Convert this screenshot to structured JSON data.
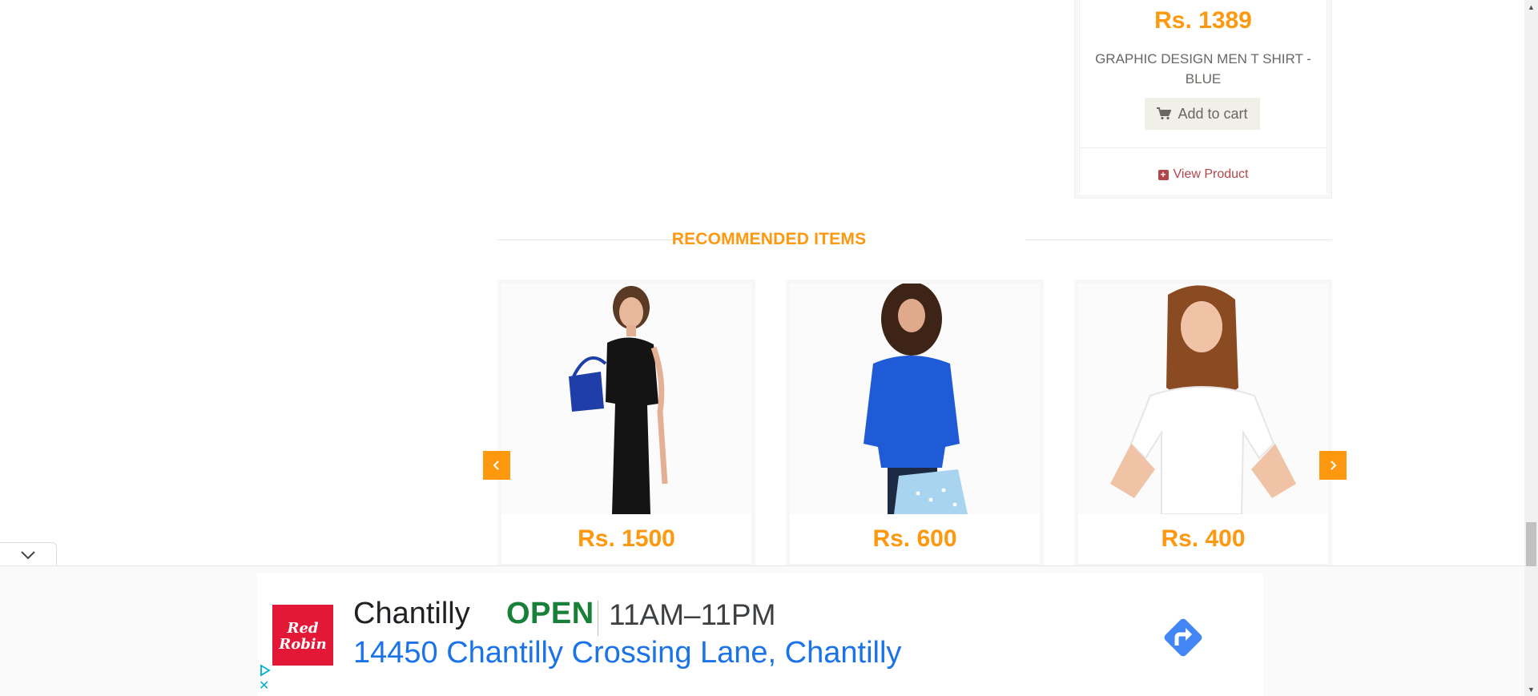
{
  "top_product": {
    "price": "Rs. 1389",
    "name": "GRAPHIC DESIGN MEN T SHIRT - BLUE",
    "add_to_cart": "Add to cart",
    "view_product": "View Product"
  },
  "recommended": {
    "title": "RECOMMENDED ITEMS",
    "items": [
      {
        "price": "Rs. 1500",
        "icon": "woman-black-dress-image"
      },
      {
        "price": "Rs. 600",
        "icon": "woman-blue-top-image"
      },
      {
        "price": "Rs. 400",
        "icon": "woman-white-tshirt-image"
      }
    ]
  },
  "ad": {
    "brand_logo_text": "Red Robin",
    "name": "Chantilly",
    "status": "OPEN",
    "hours": "11AM–11PM",
    "address": "14450 Chantilly Crossing Lane, Chantilly"
  },
  "colors": {
    "accent": "#fe980f",
    "link": "#b3464a",
    "ad_open": "#188038",
    "ad_link": "#1a73e8",
    "ad_logo": "#e31837"
  }
}
